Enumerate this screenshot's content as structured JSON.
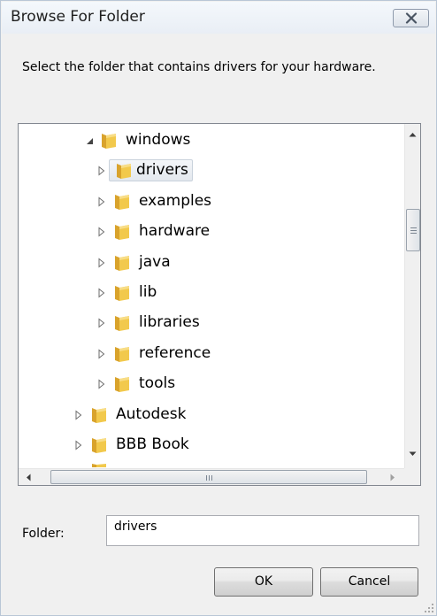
{
  "dialog": {
    "title": "Browse For Folder",
    "instruction": "Select the folder that contains drivers for your hardware."
  },
  "tree": {
    "nodes": [
      {
        "label": "windows",
        "expanded": true
      },
      {
        "label": "drivers",
        "selected": true
      },
      {
        "label": "examples"
      },
      {
        "label": "hardware"
      },
      {
        "label": "java"
      },
      {
        "label": "lib"
      },
      {
        "label": "libraries"
      },
      {
        "label": "reference"
      },
      {
        "label": "tools"
      },
      {
        "label": "Autodesk"
      },
      {
        "label": "BBB Book"
      }
    ]
  },
  "folder": {
    "label": "Folder:",
    "value": "drivers"
  },
  "buttons": {
    "ok": "OK",
    "cancel": "Cancel"
  },
  "icons": {
    "close": "close-icon",
    "folder": "folder-icon",
    "expand": "expand-triangle-icon",
    "collapse": "collapse-triangle-icon"
  },
  "colors": {
    "folder": "#e8b93b",
    "selection": "#e3e8ee"
  }
}
